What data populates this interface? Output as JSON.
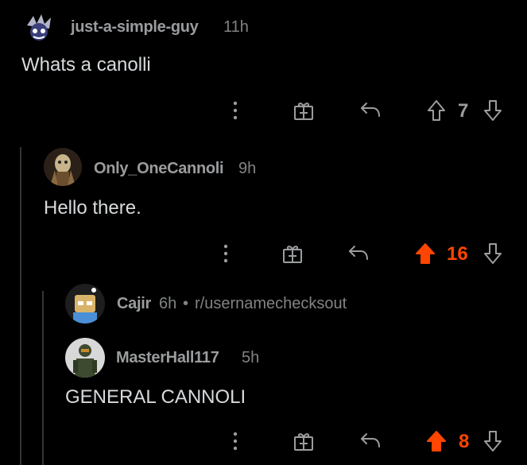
{
  "comments": [
    {
      "user": "just-a-simple-guy",
      "time": "11h",
      "body": "Whats a canolli",
      "score": "7",
      "upvoted": false
    },
    {
      "user": "Only_OneCannoli",
      "time": "9h",
      "body": "Hello there.",
      "score": "16",
      "upvoted": true
    },
    {
      "user": "Cajir",
      "time": "6h",
      "separator": "•",
      "subreddit": "r/usernamechecksout"
    },
    {
      "user": "MasterHall117",
      "time": "5h",
      "body": "GENERAL CANNOLI",
      "score": "8",
      "upvoted": true
    }
  ],
  "colors": {
    "background": "#000000",
    "upvote": "#ff4500",
    "text": "#d7dadc",
    "muted": "#9a9c9e"
  },
  "icons": [
    "more-options-icon",
    "gift-award-icon",
    "reply-icon",
    "upvote-arrow-icon",
    "downvote-arrow-icon"
  ]
}
